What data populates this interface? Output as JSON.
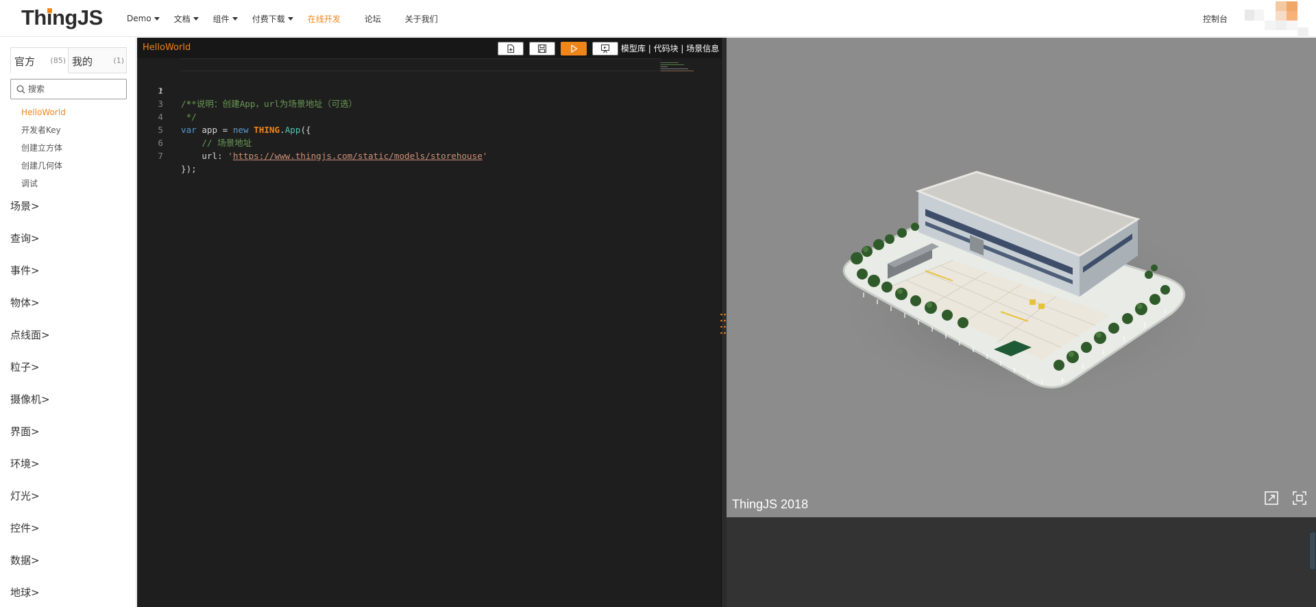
{
  "header": {
    "logo": {
      "part1": "Th",
      "dotted_i": "ı",
      "part2": "ngJS"
    },
    "nav": [
      {
        "label": "Demo",
        "dropdown": true
      },
      {
        "label": "文档",
        "dropdown": true
      },
      {
        "label": "组件",
        "dropdown": true
      },
      {
        "label": "付费下载",
        "dropdown": true
      },
      {
        "label": "在线开发",
        "dropdown": false,
        "active": true
      },
      {
        "label": "论坛",
        "dropdown": false
      },
      {
        "label": "关于我们",
        "dropdown": false
      }
    ],
    "console_label": "控制台",
    "accent_color": "#f08519"
  },
  "sidebar": {
    "tabs": [
      {
        "label": "官方",
        "count": "(85)",
        "active": true
      },
      {
        "label": "我的",
        "count": "(1)",
        "active": false
      }
    ],
    "search": {
      "placeholder": "搜索",
      "value": ""
    },
    "examples": [
      "HelloWorld",
      "开发者Key",
      "创建立方体",
      "创建几何体",
      "调试"
    ],
    "active_example": "HelloWorld",
    "categories": [
      "场景",
      "查询",
      "事件",
      "物体",
      "点线面",
      "粒子",
      "摄像机",
      "界面",
      "环境",
      "灯光",
      "控件",
      "数据",
      "地球"
    ]
  },
  "editor": {
    "file_name": "HelloWorld",
    "toolbar": {
      "buttons": [
        "new-file-icon",
        "save-icon",
        "run-icon",
        "publish-icon"
      ],
      "links": [
        "模型库",
        "代码块",
        "场景信息"
      ]
    },
    "line_numbers": [
      "1",
      "2",
      "3",
      "4",
      "5",
      "6",
      "7"
    ],
    "current_line": "1",
    "code": {
      "l1": "/**",
      "l2": " * 说明：创建App，url为场景地址（可选）",
      "l3": " */",
      "l4_kw_var": "var",
      "l4_mid": " app = ",
      "l4_kw_new": "new",
      "l4_thing": "THING",
      "l4_dot": ".",
      "l4_app": "App",
      "l4_end": "({",
      "l5": "    // 场景地址",
      "l6_key": "    url: ",
      "l6_quote_open": "'",
      "l6_url": "https://www.thingjs.com/static/models/storehouse",
      "l6_quote_close": "'",
      "l7": "});"
    }
  },
  "viewport": {
    "label": "ThingJS 2018",
    "buttons": [
      "fullscreen-icon",
      "fit-view-icon"
    ],
    "background": "#8c8c8c"
  }
}
